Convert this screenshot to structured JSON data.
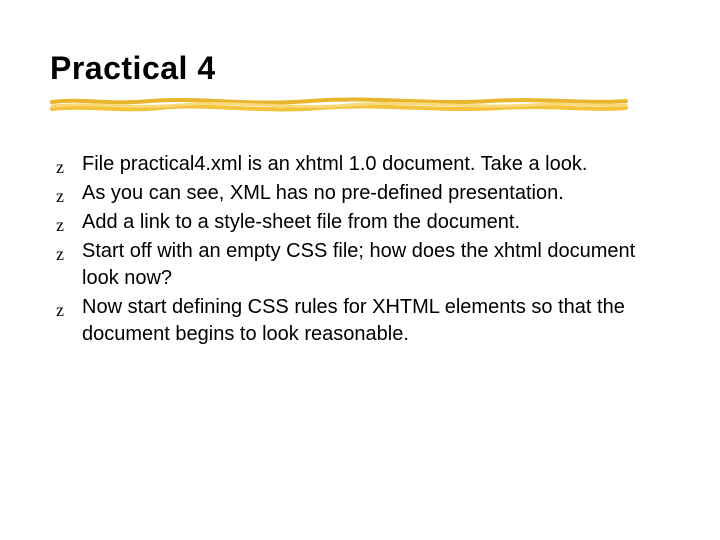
{
  "title": "Practical 4",
  "bullets": [
    "File practical4.xml is an xhtml 1.0 document. Take a look.",
    "As you can see, XML has no pre-defined presentation.",
    "Add a link to a style-sheet file from the document.",
    "Start off with an empty CSS file; how does the xhtml document look now?",
    "Now start defining CSS rules for XHTML elements so that the document begins to look reasonable."
  ],
  "bullet_glyph": "z",
  "accent_color": "#f3c33c"
}
